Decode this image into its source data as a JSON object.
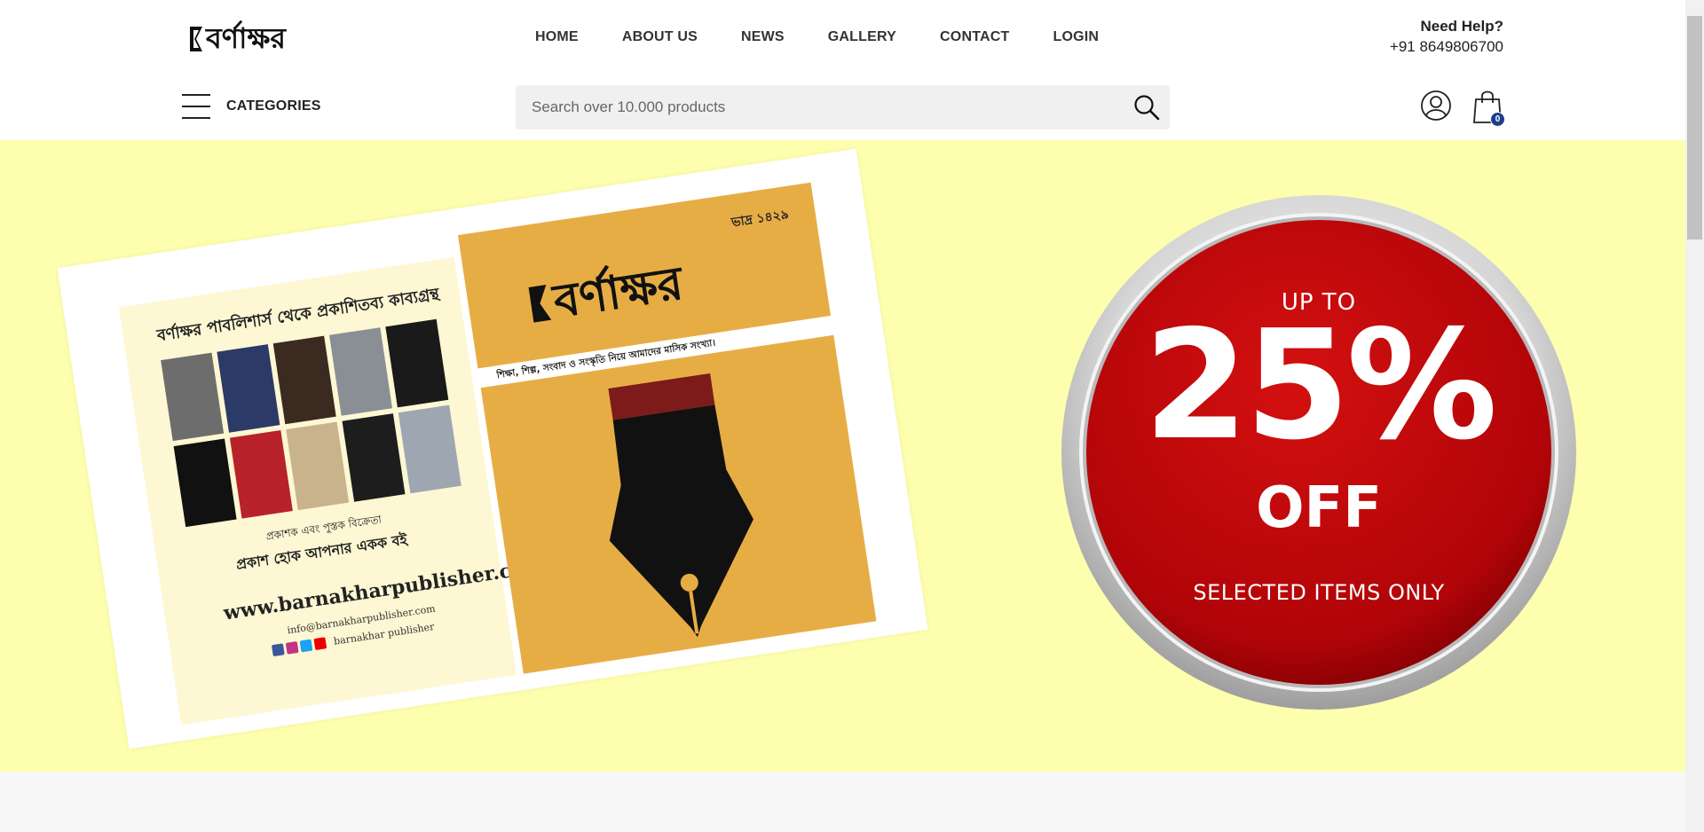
{
  "header": {
    "logo_text": "বর্ণাক্ষর",
    "nav": [
      "HOME",
      "ABOUT US",
      "NEWS",
      "GALLERY",
      "CONTACT",
      "LOGIN"
    ],
    "help_title": "Need Help?",
    "help_phone": "+91 8649806700",
    "categories_label": "CATEGORIES",
    "search_placeholder": "Search over 10.000 products",
    "cart_count": "0"
  },
  "banner": {
    "bg_color": "#fdfeae",
    "flyer": {
      "heading": "বর্ণাক্ষর পাবলিশার্স থেকে প্রকাশিতব্য কাব্যগ্রন্থ",
      "sub1": "প্রকাশক এবং পুস্তক বিক্রেতা",
      "sub2": "প্রকাশ হোক আপনার একক বই",
      "website": "www.barnakharpublisher.com",
      "email": "info@barnakharpublisher.com",
      "social": "barnakhar publisher",
      "issue": "ভাদ্র ১৪২৯",
      "magazine_title": "বর্ণাক্ষর",
      "tagline": "শিক্ষা, শিল্প, সংবাদ ও সংস্কৃতি নিয়ে আমাদের মাসিক সংখ্যা।"
    },
    "offer": {
      "up_to": "UP TO",
      "percent": "25%",
      "off": "OFF",
      "selected": "SELECTED ITEMS ONLY",
      "red": "#c0060b"
    }
  }
}
